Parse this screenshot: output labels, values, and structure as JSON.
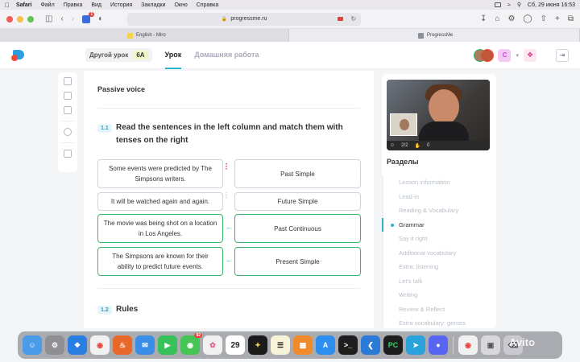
{
  "menubar": {
    "app": "Safari",
    "items": [
      "Файл",
      "Правка",
      "Вид",
      "История",
      "Закладки",
      "Окно",
      "Справка"
    ],
    "clock": "Сб, 29 июня  16:53"
  },
  "browser": {
    "url": "progressme.ru",
    "tab_badge": "1",
    "tabs": [
      {
        "label": "English - Miro",
        "color": "#f5d34a"
      },
      {
        "label": "ProgressMe",
        "color": "#8a8f99"
      }
    ]
  },
  "header": {
    "lesson_chip": "Другой урок",
    "grade": "6А",
    "nav_tabs": [
      "Урок",
      "Домашняя работа"
    ],
    "user_initial": "C",
    "accent": "#2ab6c8"
  },
  "content": {
    "section_title": "Passive voice",
    "task1": {
      "number": "1.1",
      "instruction": "Read the sentences in the left column and match them with tenses on the right",
      "left": [
        "Some events were predicted by The Simpsons writers.",
        "It will be watched again and again.",
        "The movie was being shot on a location in Los Angeles.",
        "The Simpsons are known for their ability to predict future events."
      ],
      "right": [
        "Past Simple",
        "Future Simple",
        "Past Continuous",
        "Present Simple"
      ]
    },
    "task2": {
      "number": "1.2",
      "title": "Rules"
    }
  },
  "sidebar": {
    "participants": "2/2",
    "hands": "0",
    "title": "Разделы",
    "sections": [
      "Lesson information",
      "Lead-in",
      "Reading & Vocabulary",
      "Grammar",
      "Say it right",
      "Additional vocabulary",
      "Extra: listening",
      "Let's talk",
      "Writing",
      "Review & Reflect",
      "Extra vocabulary: genres"
    ],
    "active_section": "Grammar"
  },
  "dock": {
    "calendar_day": "29",
    "mail_badge": "92",
    "watermark": "Avito"
  }
}
